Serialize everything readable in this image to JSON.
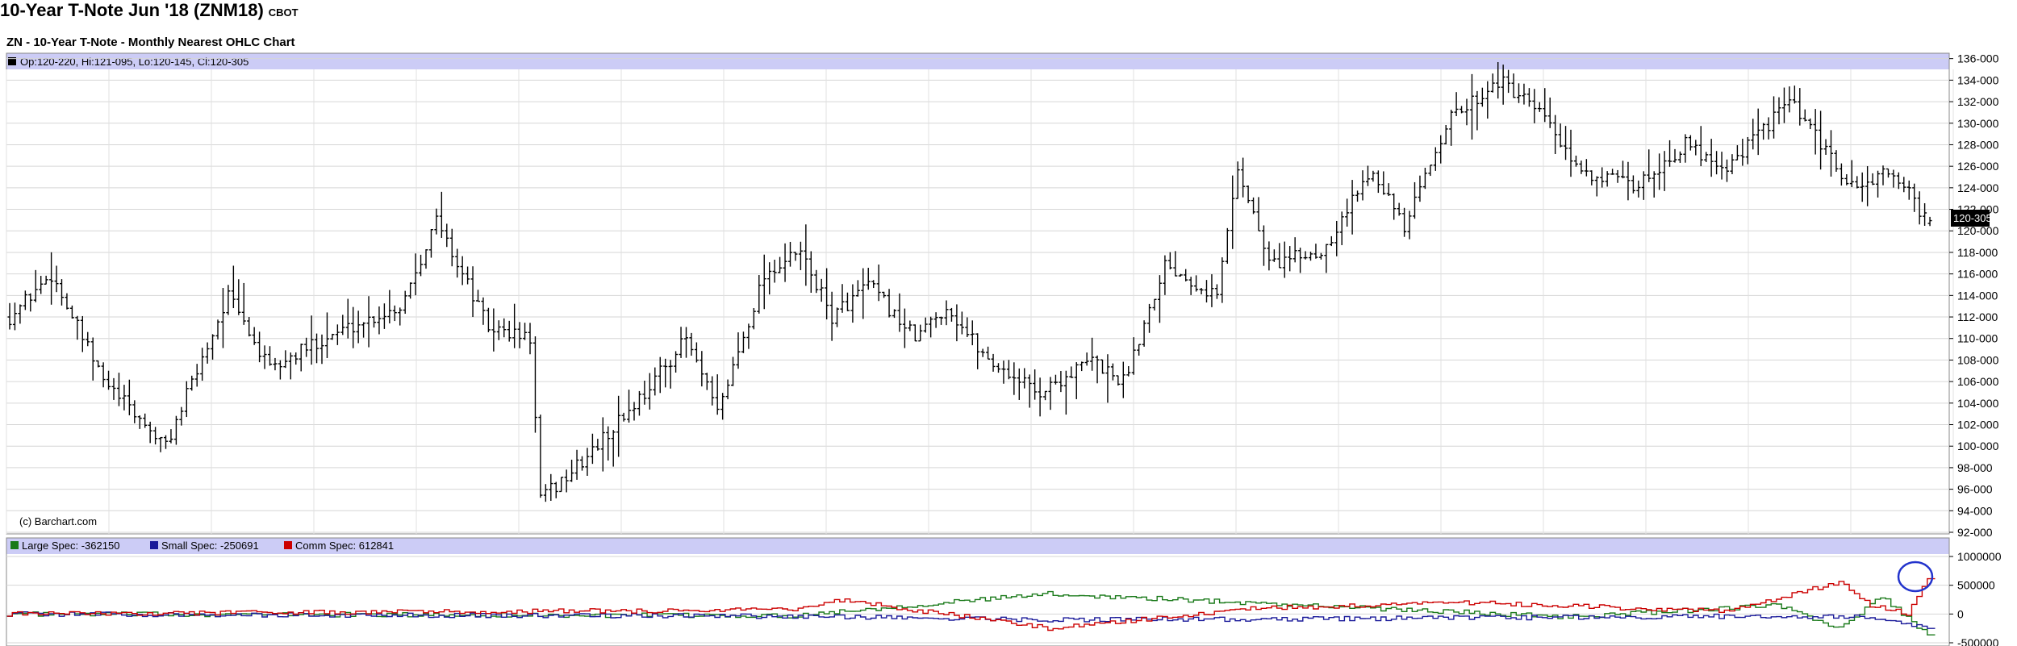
{
  "header": {
    "title": "10-Year T-Note Jun '18 (ZNM18)",
    "exchange": "CBOT",
    "subtitle": "ZN - 10-Year T-Note - Monthly Nearest OHLC Chart"
  },
  "price_panel": {
    "info_line": "Op:120-220, Hi:121-095, Lo:120-145, Cl:120-305",
    "watermark": "(c) Barchart.com",
    "last_label": "120-305"
  },
  "cot_panel": {
    "legend": [
      {
        "label": "Large Spec: -362150",
        "color": "#1a7a1a"
      },
      {
        "label": "Small Spec: -250691",
        "color": "#1a1a9a"
      },
      {
        "label": "Comm Spec: 612841",
        "color": "#cc0000"
      }
    ]
  },
  "chart_data": [
    {
      "type": "ohlc",
      "title": "ZN - 10-Year T-Note - Monthly Nearest OHLC Chart",
      "y_ticks": [
        "92-000",
        "94-000",
        "96-000",
        "98-000",
        "100-000",
        "102-000",
        "104-000",
        "106-000",
        "108-000",
        "110-000",
        "112-000",
        "114-000",
        "116-000",
        "118-000",
        "120-000",
        "122-000",
        "124-000",
        "126-000",
        "128-000",
        "130-000",
        "132-000",
        "134-000",
        "136-000"
      ],
      "ylim": [
        92,
        136.5
      ],
      "grid": true,
      "legend_position": "top-left",
      "anchors": [
        {
          "i": 0,
          "p": 112
        },
        {
          "i": 8,
          "p": 116
        },
        {
          "i": 18,
          "p": 106
        },
        {
          "i": 30,
          "p": 100
        },
        {
          "i": 42,
          "p": 114
        },
        {
          "i": 50,
          "p": 107
        },
        {
          "i": 60,
          "p": 110
        },
        {
          "i": 75,
          "p": 113
        },
        {
          "i": 82,
          "p": 121
        },
        {
          "i": 92,
          "p": 111
        },
        {
          "i": 100,
          "p": 110
        },
        {
          "i": 102,
          "p": 95
        },
        {
          "i": 110,
          "p": 98.5
        },
        {
          "i": 122,
          "p": 105
        },
        {
          "i": 130,
          "p": 110
        },
        {
          "i": 136,
          "p": 103
        },
        {
          "i": 145,
          "p": 116
        },
        {
          "i": 152,
          "p": 118
        },
        {
          "i": 158,
          "p": 112
        },
        {
          "i": 165,
          "p": 115
        },
        {
          "i": 174,
          "p": 110
        },
        {
          "i": 180,
          "p": 113
        },
        {
          "i": 188,
          "p": 108
        },
        {
          "i": 198,
          "p": 105
        },
        {
          "i": 208,
          "p": 108
        },
        {
          "i": 214,
          "p": 106
        },
        {
          "i": 222,
          "p": 117
        },
        {
          "i": 232,
          "p": 114
        },
        {
          "i": 236,
          "p": 126
        },
        {
          "i": 242,
          "p": 117
        },
        {
          "i": 252,
          "p": 118
        },
        {
          "i": 262,
          "p": 126
        },
        {
          "i": 268,
          "p": 120
        },
        {
          "i": 276,
          "p": 130
        },
        {
          "i": 286,
          "p": 134
        },
        {
          "i": 296,
          "p": 130
        },
        {
          "i": 300,
          "p": 126
        },
        {
          "i": 312,
          "p": 124
        },
        {
          "i": 322,
          "p": 128
        },
        {
          "i": 330,
          "p": 126
        },
        {
          "i": 342,
          "p": 132
        },
        {
          "i": 348,
          "p": 128
        },
        {
          "i": 354,
          "p": 124
        },
        {
          "i": 362,
          "p": 125.5
        },
        {
          "i": 369,
          "p": 120.5
        }
      ],
      "last": {
        "open": 120.69,
        "high": 121.3,
        "low": 120.45,
        "close": 120.95
      }
    },
    {
      "type": "line",
      "title": "COT positions",
      "y_ticks": [
        "1000000",
        "500000",
        "0",
        "-500000"
      ],
      "ylim": [
        -500000,
        1000000
      ],
      "series": [
        {
          "name": "Large Spec",
          "color": "#1a7a1a",
          "last": -362150,
          "anchors": [
            {
              "i": 0,
              "v": 0
            },
            {
              "i": 150,
              "v": -30000
            },
            {
              "i": 200,
              "v": 350000
            },
            {
              "i": 250,
              "v": 150000
            },
            {
              "i": 300,
              "v": -50000
            },
            {
              "i": 340,
              "v": 150000
            },
            {
              "i": 352,
              "v": -250000
            },
            {
              "i": 360,
              "v": 300000
            },
            {
              "i": 369,
              "v": -362150
            }
          ]
        },
        {
          "name": "Small Spec",
          "color": "#1a1a9a",
          "last": -250691,
          "anchors": [
            {
              "i": 0,
              "v": 0
            },
            {
              "i": 150,
              "v": -40000
            },
            {
              "i": 200,
              "v": -100000
            },
            {
              "i": 260,
              "v": -80000
            },
            {
              "i": 330,
              "v": -40000
            },
            {
              "i": 360,
              "v": -60000
            },
            {
              "i": 369,
              "v": -250691
            }
          ]
        },
        {
          "name": "Comm Spec",
          "color": "#cc0000",
          "last": 612841,
          "anchors": [
            {
              "i": 0,
              "v": 0
            },
            {
              "i": 150,
              "v": 70000
            },
            {
              "i": 160,
              "v": 250000
            },
            {
              "i": 200,
              "v": -250000
            },
            {
              "i": 240,
              "v": 100000
            },
            {
              "i": 280,
              "v": 200000
            },
            {
              "i": 330,
              "v": 50000
            },
            {
              "i": 352,
              "v": 550000
            },
            {
              "i": 358,
              "v": 150000
            },
            {
              "i": 365,
              "v": 0
            },
            {
              "i": 369,
              "v": 612841
            }
          ]
        }
      ]
    }
  ]
}
